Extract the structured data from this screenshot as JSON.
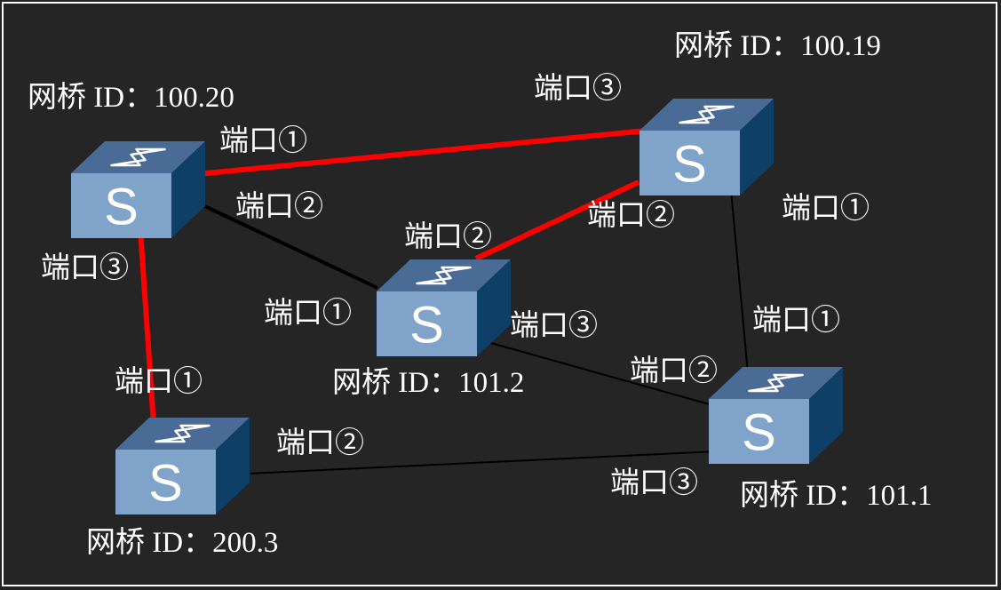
{
  "bridges": [
    {
      "name": "bridge-a",
      "id_label": "网桥 ID：100.20",
      "letter": "S"
    },
    {
      "name": "bridge-b",
      "id_label": "网桥 ID：100.19",
      "letter": "S"
    },
    {
      "name": "bridge-c",
      "id_label": "网桥 ID：101.2",
      "letter": "S"
    },
    {
      "name": "bridge-d",
      "id_label": "网桥 ID：200.3",
      "letter": "S"
    },
    {
      "name": "bridge-e",
      "id_label": "网桥 ID：101.1",
      "letter": "S"
    }
  ],
  "ports": [
    {
      "name": "port-a1",
      "text": "端口①"
    },
    {
      "name": "port-a2",
      "text": "端口②"
    },
    {
      "name": "port-a3",
      "text": "端口③"
    },
    {
      "name": "port-b3",
      "text": "端口③"
    },
    {
      "name": "port-b2",
      "text": "端口②"
    },
    {
      "name": "port-b1",
      "text": "端口①"
    },
    {
      "name": "port-c2",
      "text": "端口②"
    },
    {
      "name": "port-c1",
      "text": "端口①"
    },
    {
      "name": "port-c3",
      "text": "端口③"
    },
    {
      "name": "port-d1",
      "text": "端口①"
    },
    {
      "name": "port-d2",
      "text": "端口②"
    },
    {
      "name": "port-e1",
      "text": "端口①"
    },
    {
      "name": "port-e2",
      "text": "端口②"
    },
    {
      "name": "port-e3",
      "text": "端口③"
    }
  ],
  "links": [
    {
      "name": "link-a-b",
      "from": "bridge-a",
      "to": "bridge-b",
      "active": true
    },
    {
      "name": "link-b-c",
      "from": "bridge-b",
      "to": "bridge-c",
      "active": true
    },
    {
      "name": "link-a-d",
      "from": "bridge-a",
      "to": "bridge-d",
      "active": true
    },
    {
      "name": "link-a-c",
      "from": "bridge-a",
      "to": "bridge-c",
      "active": false
    },
    {
      "name": "link-c-e",
      "from": "bridge-c",
      "to": "bridge-e",
      "active": false
    },
    {
      "name": "link-b-e",
      "from": "bridge-b",
      "to": "bridge-e",
      "active": false
    },
    {
      "name": "link-d-e",
      "from": "bridge-d",
      "to": "bridge-e",
      "active": false
    }
  ],
  "colors": {
    "background": "#252525",
    "active_link": "#ff0000",
    "inactive_link": "#000000",
    "switch_front": "#7fa3c9",
    "switch_top": "#4a6b95",
    "switch_side": "#0e3f66"
  }
}
